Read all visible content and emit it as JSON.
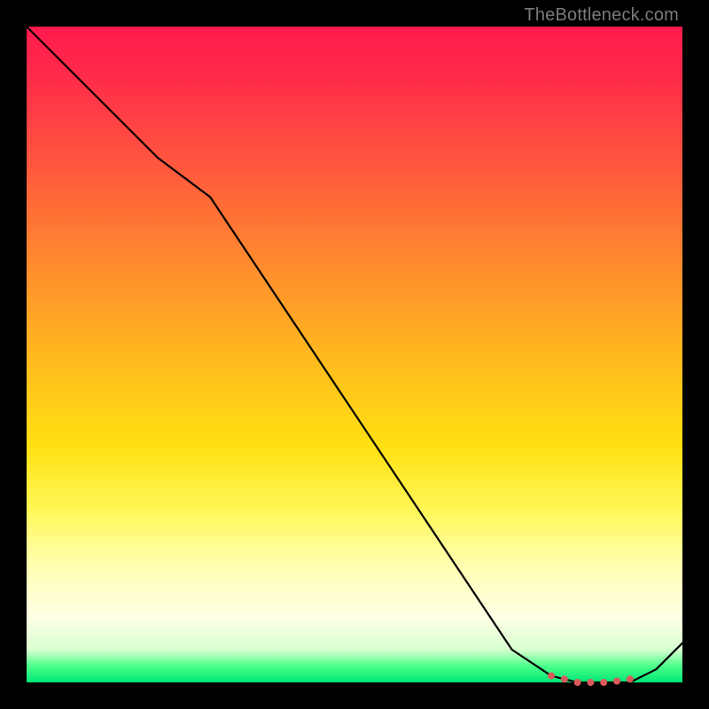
{
  "watermark": "TheBottleneck.com",
  "colors": {
    "frame": "#000000",
    "curve": "#000000",
    "dot": "#d85a5a",
    "top": "#ff1a4d",
    "mid": "#ffe012",
    "bottom": "#00e676"
  },
  "chart_data": {
    "type": "line",
    "title": "",
    "xlabel": "",
    "ylabel": "",
    "xlim": [
      0,
      100
    ],
    "ylim": [
      0,
      100
    ],
    "grid": false,
    "annotations": [
      "TheBottleneck.com"
    ],
    "x": [
      0,
      10,
      20,
      28,
      40,
      52,
      64,
      74,
      80,
      84,
      88,
      92,
      96,
      100
    ],
    "values": [
      100,
      90,
      80,
      74,
      56,
      38,
      20,
      5,
      1,
      0,
      0,
      0,
      2,
      6
    ],
    "dots_x": [
      80,
      82,
      84,
      86,
      88,
      90,
      92
    ],
    "dots_y": [
      1,
      0.5,
      0,
      0,
      0,
      0.2,
      0.5
    ]
  }
}
